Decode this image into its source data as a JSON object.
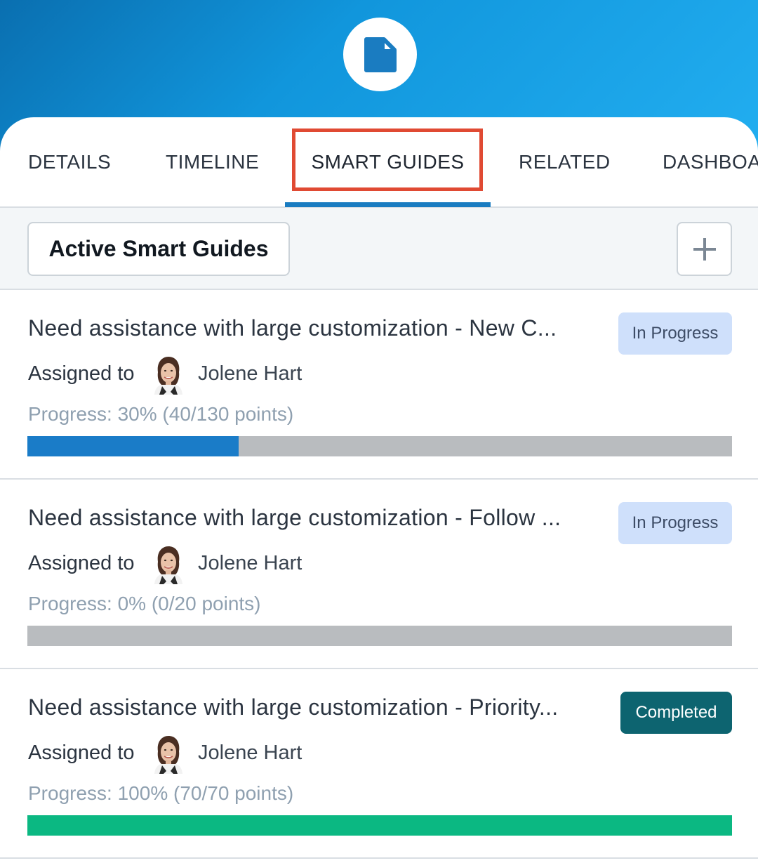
{
  "header": {
    "icon": "document-icon",
    "accent_color": "#1196dc"
  },
  "tabs": [
    {
      "label": "DETAILS",
      "active": false
    },
    {
      "label": "TIMELINE",
      "active": false
    },
    {
      "label": "SMART GUIDES",
      "active": true
    },
    {
      "label": "RELATED",
      "active": false
    },
    {
      "label": "DASHBOA",
      "active": false
    }
  ],
  "toolbar": {
    "filter_label": "Active Smart Guides",
    "add_icon": "plus-icon"
  },
  "guides": [
    {
      "title": "Need assistance with large customization - New C...",
      "status": "In Progress",
      "assigned_label": "Assigned to",
      "assignee": "Jolene Hart",
      "progress_text": "Progress: 30% (40/130 points)",
      "progress_fraction": 0.3,
      "bar_color": "#1a7cc8"
    },
    {
      "title": "Need assistance with large customization - Follow ...",
      "status": "In Progress",
      "assigned_label": "Assigned to",
      "assignee": "Jolene Hart",
      "progress_text": "Progress: 0% (0/20 points)",
      "progress_fraction": 0.0,
      "bar_color": "#1a7cc8"
    },
    {
      "title": "Need assistance with large customization - Priority...",
      "status": "Completed",
      "assigned_label": "Assigned to",
      "assignee": "Jolene Hart",
      "progress_text": "Progress: 100% (70/70 points)",
      "progress_fraction": 1.0,
      "bar_color": "#0bb882"
    }
  ]
}
